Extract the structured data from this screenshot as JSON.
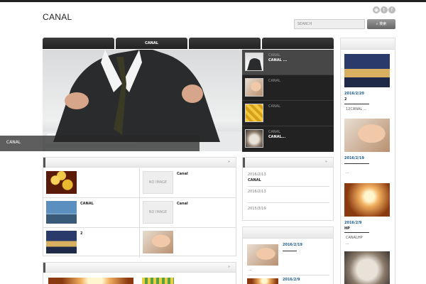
{
  "header": {
    "logo": "CANAL",
    "search": {
      "placeholder": "SEARCH",
      "button_label": "検索"
    },
    "social": [
      "rss-icon",
      "twitter-icon",
      "facebook-icon"
    ]
  },
  "nav": {
    "tabs": [
      "",
      "CANAL",
      "",
      ""
    ]
  },
  "slider": {
    "caption": "CANAL",
    "items": [
      {
        "sub": "CANAL",
        "title": "CANAL ..."
      },
      {
        "sub": "CANAL",
        "title": ""
      },
      {
        "sub": "CANAL",
        "title": ""
      },
      {
        "sub": "CANAL",
        "title": "CANAL..."
      }
    ]
  },
  "grid": {
    "arrow": "»",
    "no_image": "NO IMAGE",
    "cells": [
      "",
      "Canal",
      "CANAL",
      "Canal",
      "2",
      ""
    ]
  },
  "news": {
    "arrow": "»",
    "items": [
      {
        "date": "2016/2/13",
        "title": "CANAL"
      },
      {
        "date": "2016/2/13",
        "title": ""
      },
      {
        "date": "2015/3/19",
        "title": ""
      }
    ]
  },
  "recent": {
    "items": [
      {
        "date": "2016/2/19",
        "text": "..."
      },
      {
        "date": "2016/2/9",
        "text": ""
      }
    ]
  },
  "bottom_panel": {
    "arrow": "»"
  },
  "right_column": {
    "items": [
      {
        "date": "2016/2/20",
        "title": "2",
        "text": "12CANAL ..."
      },
      {
        "date": "2016/2/19",
        "title": "",
        "text": "..."
      },
      {
        "date": "2016/2/9",
        "title": "HP",
        "text": "CANALHP"
      }
    ],
    "extra_text": "..."
  }
}
